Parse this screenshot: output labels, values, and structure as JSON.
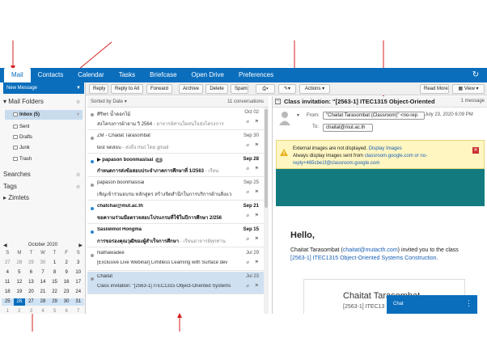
{
  "colors": {
    "accent": "#0a6ebd",
    "annotation": "#d6211e",
    "teal": "#137b80",
    "warning_bg": "#fff6c2"
  },
  "tabs": [
    {
      "label": "Mail",
      "active": true
    },
    {
      "label": "Contacts"
    },
    {
      "label": "Calendar"
    },
    {
      "label": "Tasks"
    },
    {
      "label": "Briefcase"
    },
    {
      "label": "Open Drive"
    },
    {
      "label": "Preferences"
    }
  ],
  "sidebar": {
    "new_message": "New Message",
    "mail_folders": "Mail Folders",
    "folders": [
      {
        "label": "Inbox (5)",
        "selected": true
      },
      {
        "label": "Sent"
      },
      {
        "label": "Drafts"
      },
      {
        "label": "Junk"
      },
      {
        "label": "Trash"
      }
    ],
    "searches": "Searches",
    "tags": "Tags",
    "zimlets": "Zimlets"
  },
  "calendar": {
    "month": "October 2020",
    "prev": "◀",
    "next": "▶",
    "dow": [
      "S",
      "M",
      "T",
      "W",
      "T",
      "F",
      "S"
    ],
    "weeks": [
      [
        "27",
        "28",
        "29",
        "30",
        "1",
        "2",
        "3"
      ],
      [
        "4",
        "5",
        "6",
        "7",
        "8",
        "9",
        "10"
      ],
      [
        "11",
        "12",
        "13",
        "14",
        "15",
        "16",
        "17"
      ],
      [
        "18",
        "19",
        "20",
        "21",
        "22",
        "23",
        "24"
      ],
      [
        "25",
        "26",
        "27",
        "28",
        "29",
        "30",
        "31"
      ],
      [
        "1",
        "2",
        "3",
        "4",
        "5",
        "6",
        "7"
      ]
    ],
    "today": "26"
  },
  "toolbar": {
    "reply": "Reply",
    "reply_all": "Reply to All",
    "forward": "Forward",
    "archive": "Archive",
    "delete": "Delete",
    "spam": "Spam",
    "actions": "Actions",
    "read_more": "Read More",
    "view": "View"
  },
  "list": {
    "sort_label": "Sorted by Date",
    "count": "11 conversations",
    "rows": [
      {
        "sender": "ศิริพร น้ำดอกไม้",
        "date": "Oct 02",
        "subject": "ส่งโครงการผ้าอาม วิ 2564",
        "snippet": " - อาจารย์ท่านใดสนใจส่งโครงการ",
        "unread": false,
        "dot": "gray"
      },
      {
        "sender": "ZM - Chaitat Tarasombat",
        "date": "Sep 30",
        "subject": "test จดสอบ",
        "snippet": " - ส่งถึง mut โดย gmail",
        "unread": false,
        "dot": "gray"
      },
      {
        "sender": "▶ papason boonmasisai",
        "badge": "2",
        "date": "Sep 28",
        "subject": "กำหนดการส่งข้อสอบประจำภาคการศึกษาที่ 1/2563",
        "snippet": " - เรียน",
        "unread": true,
        "dot": "blue"
      },
      {
        "sender": "papason boonmasisai",
        "date": "Sep 25",
        "subject": "เชิญเข้าร่วมอบรม หลักสูตร สร้างจิตสำนึกในการบริการด้านสิ่งแวด",
        "snippet": "",
        "unread": false,
        "dot": "gray"
      },
      {
        "sender": "chatchai@mut.ac.th",
        "date": "Sep 21",
        "subject": "ขอความร่วมมือตรวจสอบโปรแกรมที่ใช้ในปีการศึกษา 2/256",
        "snippet": "",
        "unread": true,
        "dot": "blue"
      },
      {
        "sender": "Sasiwimol Hongma",
        "date": "Sep 15",
        "subject": "การขอรองคุณวุฒิของผู้สำเร็จการศึกษา",
        "snippet": " - เรียนอาจารย์ทุกท่าน",
        "unread": true,
        "dot": "blue"
      },
      {
        "sender": "Nathawadee",
        "date": "Jul 29",
        "subject": "[Exclusive Live Webinar] Limitless Learning with Surface dev",
        "snippet": "",
        "unread": false,
        "dot": "gray"
      },
      {
        "sender": "Chaitat",
        "date": "Jul 23",
        "subject": "Class invitation: \"[2563-1] ITEC1315 Object-Oriented Systems Cons",
        "snippet": "",
        "unread": false,
        "dot": "gray",
        "selected": true
      }
    ]
  },
  "reading": {
    "title": "Class invitation: \"[2563-1] ITEC1315 Object-Oriented",
    "msg_count": "1 message",
    "from_label": "From:",
    "from_value": "\"Chaitat Tarasombat (Classroom)\" <no-rep",
    "date": "July 23, 2020 6:09 PM",
    "to_label": "To:",
    "to_value": "chaitat@mut.ac.th",
    "warning": {
      "line1_text": "External images are not displayed.",
      "line1_link": "Display Images",
      "line2_text": "Always display images sent from",
      "line2_link": "classroom.google.com or no-",
      "line3_link": "reply+465cbe1f@classroom.google.com"
    },
    "hello": "Hello,",
    "body_pre": "Chaitat Tarasombat (",
    "body_link": "chaitat@mutacth.com",
    "body_mid": ") invited you to the class ",
    "body_class": "[2563-1] ITEC1315 Object-Oriented Systems Construction",
    "body_end": ".",
    "card_title": "Chaitat Tarasombat",
    "card_sub": "[2563-1] ITEC13"
  },
  "chat": {
    "label": "Chat"
  }
}
